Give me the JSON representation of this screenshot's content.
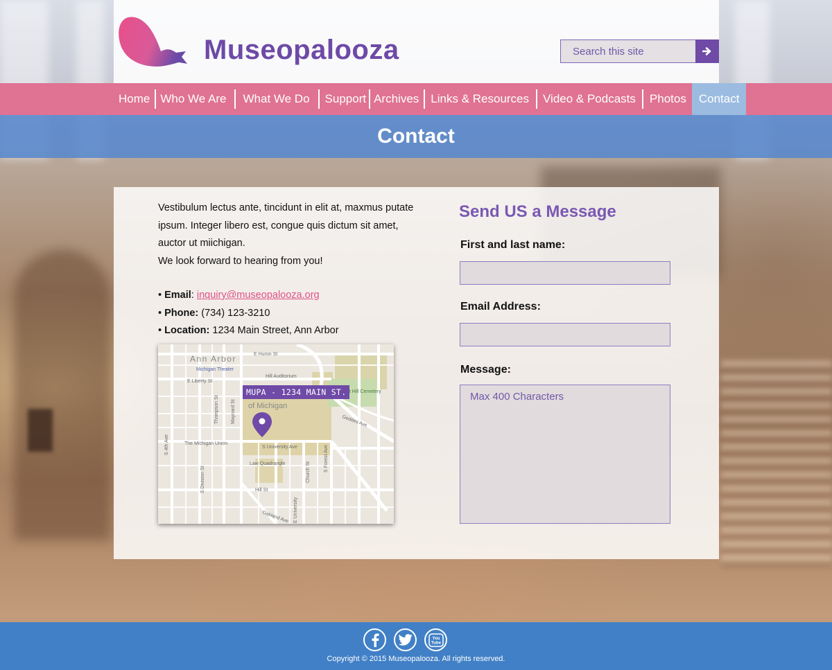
{
  "site": {
    "name": "Museopalooza"
  },
  "search": {
    "placeholder": "Search this site",
    "button_icon": "arrow-right-icon"
  },
  "nav": {
    "items": [
      "Home",
      "Who We Are",
      "What We Do",
      "Support",
      "Archives",
      "Links & Resources",
      "Video & Podcasts",
      "Photos",
      "Contact"
    ],
    "active": "Contact"
  },
  "page": {
    "title": "Contact"
  },
  "intro": {
    "line1": "Vestibulum lectus ante, tincidunt in elit at, maxmus putate ipsum. Integer libero est, congue quis dictum sit amet, auctor ut miichigan.",
    "line2": "We look forward to hearing from you!"
  },
  "contact": {
    "email_label": "Email",
    "email": "inquiry@museopalooza.org",
    "phone_label": "Phone:",
    "phone": "(734) 123-3210",
    "location_label": "Location:",
    "location": "1234 Main Street, Ann Arbor"
  },
  "map": {
    "marker_label": "MUPA - 1234 MAIN ST.",
    "labels": [
      "Ann Arbor",
      "E Huron St",
      "Michigan Theater",
      "E Liberty St",
      "Hill Auditorium",
      "Forest Hill Cemetery",
      "Geddes Ave",
      "The Michigan Union",
      "S University Ave",
      "Law Quadrangle",
      "Hill St",
      "Oakland Ave",
      "of Michigan",
      "S 4th Ave",
      "S Division St",
      "S Forest Ave",
      "Church St",
      "Thompson St",
      "Maynard St",
      "E University"
    ]
  },
  "form": {
    "title": "Send US a Message",
    "name_label": "First and last name:",
    "email_label": "Email Address:",
    "message_label": "Message:",
    "message_placeholder": "Max 400 Characters"
  },
  "footer": {
    "social": [
      "facebook-icon",
      "twitter-icon",
      "youtube-icon"
    ],
    "youtube_text": "You Tube",
    "copyright": "Copyright © 2015 Museopalooza. All rights reserved."
  },
  "colors": {
    "purple": "#6f4aa7",
    "pink": "#e07293",
    "blue": "#4180c6",
    "active_tab": "#9bbce0"
  }
}
